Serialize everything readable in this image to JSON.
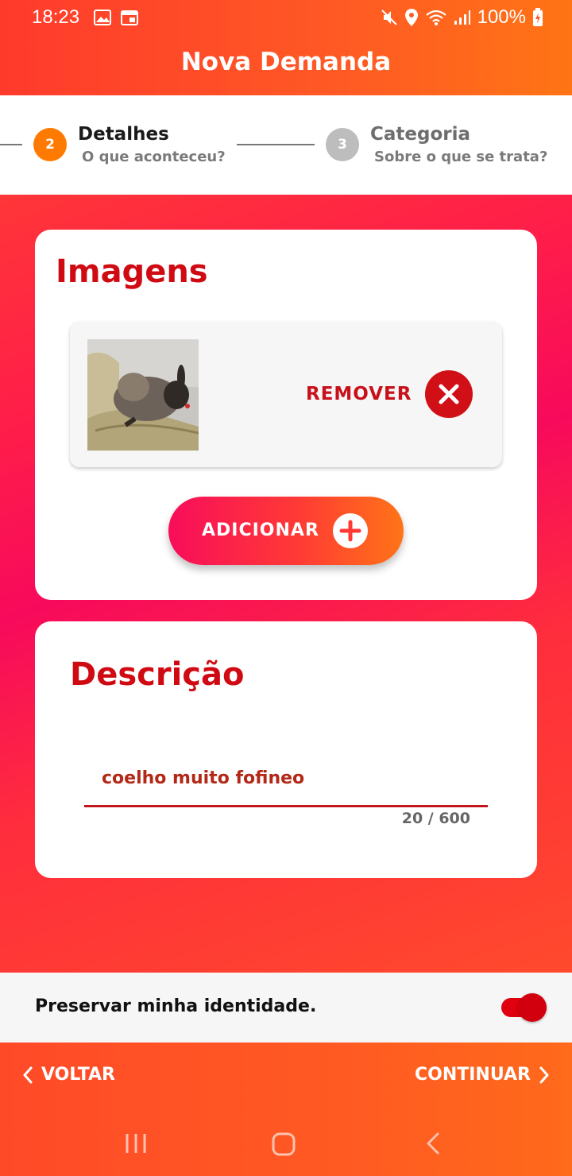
{
  "status_bar": {
    "time": "18:23",
    "battery": "100%",
    "icons": [
      "gallery-icon",
      "calendar-icon",
      "mute-icon",
      "location-icon",
      "wifi-icon",
      "signal-icon",
      "battery-charging-icon"
    ]
  },
  "header": {
    "title": "Nova Demanda"
  },
  "stepper": {
    "steps": [
      {
        "number": "2",
        "title": "Detalhes",
        "subtitle": "O que aconteceu?",
        "active": true
      },
      {
        "number": "3",
        "title": "Categoria",
        "subtitle": "Sobre o que se trata?",
        "active": false
      }
    ],
    "active_color": "#ff7a00",
    "inactive_color": "#bdbdbd"
  },
  "images_card": {
    "title": "Imagens",
    "remove_label": "REMOVER",
    "add_label": "ADICIONAR"
  },
  "description_card": {
    "title": "Descrição",
    "value": "coelho muito fofineo",
    "counter": "20 / 600"
  },
  "identity": {
    "label": "Preservar minha identidade.",
    "toggle_on": true
  },
  "footer": {
    "back_label": "VOLTAR",
    "continue_label": "CONTINUAR"
  },
  "colors": {
    "accent_red": "#d00a12",
    "gradient_pink": "#f80d5b",
    "gradient_orange": "#ff7417"
  }
}
